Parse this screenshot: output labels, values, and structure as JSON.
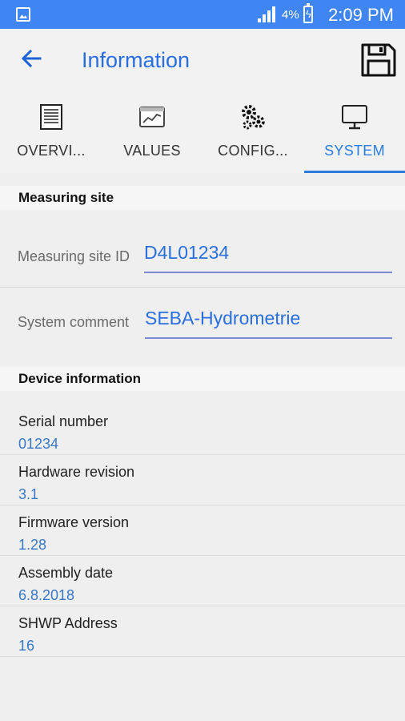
{
  "status_bar": {
    "battery_percent": "4%",
    "time": "2:09 PM"
  },
  "app_bar": {
    "title": "Information"
  },
  "tabs": [
    {
      "label": "OVERVI...",
      "icon": "document-icon"
    },
    {
      "label": "VALUES",
      "icon": "chart-icon"
    },
    {
      "label": "CONFIG...",
      "icon": "gears-icon"
    },
    {
      "label": "SYSTEM",
      "icon": "monitor-icon",
      "active": true
    }
  ],
  "measuring_site": {
    "header": "Measuring site",
    "site_id_label": "Measuring site ID",
    "site_id_value": "D4L01234",
    "comment_label": "System comment",
    "comment_value": "SEBA-Hydrometrie"
  },
  "device_information": {
    "header": "Device information",
    "rows": [
      {
        "label": "Serial number",
        "value": "01234"
      },
      {
        "label": "Hardware revision",
        "value": "3.1"
      },
      {
        "label": "Firmware version",
        "value": "1.28"
      },
      {
        "label": "Assembly date",
        "value": "6.8.2018"
      },
      {
        "label": "SHWP Address",
        "value": "16"
      }
    ]
  },
  "colors": {
    "status_bar": "#3f86f4",
    "accent": "#2a6fe0",
    "value_blue": "#3878c6"
  }
}
